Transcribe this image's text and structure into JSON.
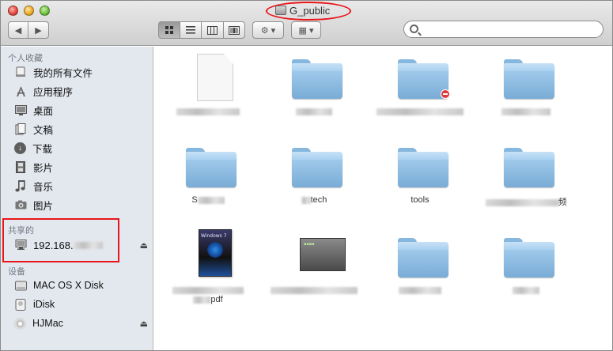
{
  "window": {
    "title": "G_public"
  },
  "toolbar": {
    "back_glyph": "◀",
    "forward_glyph": "▶",
    "view_icons": [
      "icon-view-icon",
      "list-view-icon",
      "column-view-icon",
      "coverflow-view-icon"
    ],
    "action_glyph": "⚙ ▾",
    "arrange_glyph": "▦ ▾",
    "search_placeholder": ""
  },
  "sidebar": {
    "favorites_head": "个人收藏",
    "favorites": [
      {
        "label": "我的所有文件",
        "icon": "all-files-icon"
      },
      {
        "label": "应用程序",
        "icon": "applications-icon"
      },
      {
        "label": "桌面",
        "icon": "desktop-icon"
      },
      {
        "label": "文稿",
        "icon": "documents-icon"
      },
      {
        "label": "下载",
        "icon": "downloads-icon"
      },
      {
        "label": "影片",
        "icon": "movies-icon"
      },
      {
        "label": "音乐",
        "icon": "music-icon"
      },
      {
        "label": "图片",
        "icon": "pictures-icon"
      }
    ],
    "shared_head": "共享的",
    "shared": [
      {
        "label": "192.168.",
        "icon": "network-server-icon"
      }
    ],
    "devices_head": "设备",
    "devices": [
      {
        "label": "MAC OS X Disk",
        "icon": "hard-disk-icon"
      },
      {
        "label": "iDisk",
        "icon": "idisk-icon"
      },
      {
        "label": "HJMac",
        "icon": "disc-icon"
      }
    ],
    "eject_glyph": "⏏"
  },
  "files": [
    {
      "kind": "document",
      "label_prefix": "",
      "label_suffix": ""
    },
    {
      "kind": "folder",
      "label_prefix": "",
      "label_suffix": ""
    },
    {
      "kind": "folder-restricted",
      "label_prefix": "",
      "label_suffix": ""
    },
    {
      "kind": "folder",
      "label_prefix": "",
      "label_suffix": ""
    },
    {
      "kind": "folder",
      "label_prefix": "S",
      "label_suffix": ""
    },
    {
      "kind": "folder",
      "label_prefix": "",
      "label_suffix": "tech"
    },
    {
      "kind": "folder",
      "label_prefix": "",
      "label_suffix": "tools"
    },
    {
      "kind": "folder",
      "label_prefix": "",
      "label_suffix": "频"
    },
    {
      "kind": "pdf-book",
      "label_prefix": "",
      "label_suffix": "pdf",
      "cover_text": "Windows 7"
    },
    {
      "kind": "image",
      "label_prefix": "",
      "label_suffix": ""
    },
    {
      "kind": "folder",
      "label_prefix": "",
      "label_suffix": ""
    },
    {
      "kind": "folder",
      "label_prefix": "",
      "label_suffix": ""
    }
  ],
  "colors": {
    "annotation_red": "#e8161b",
    "sidebar_bg": "#e3e8ee",
    "folder_blue": "#79acd6"
  }
}
